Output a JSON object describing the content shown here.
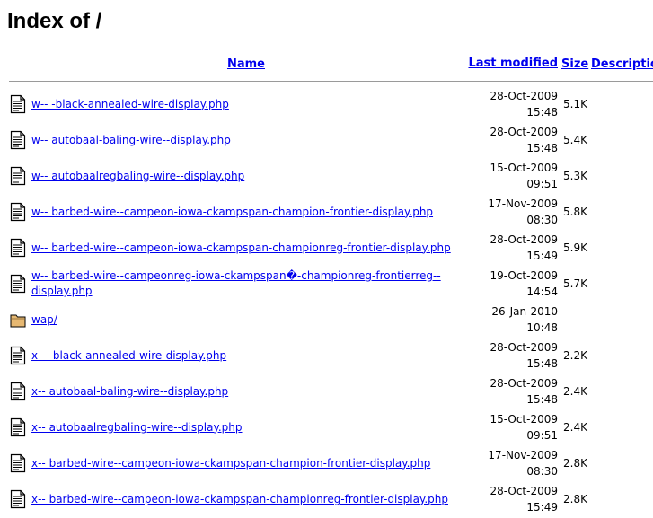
{
  "page": {
    "title": "Index of /"
  },
  "columns": {
    "name": "Name",
    "last_modified": "Last modified",
    "size": "Size",
    "description": "Description"
  },
  "rows": [
    {
      "icon": "text-file-icon",
      "name": "w-- -black-annealed-wire-display.php",
      "date": "28-Oct-2009",
      "time": "15:48",
      "size": "5.1K"
    },
    {
      "icon": "text-file-icon",
      "name": "w-- autobaal-baling-wire--display.php",
      "date": "28-Oct-2009",
      "time": "15:48",
      "size": "5.4K"
    },
    {
      "icon": "text-file-icon",
      "name": "w-- autobaalregbaling-wire--display.php",
      "date": "15-Oct-2009",
      "time": "09:51",
      "size": "5.3K"
    },
    {
      "icon": "text-file-icon",
      "name": "w-- barbed-wire--campeon-iowa-ckampspan-champion-frontier-display.php",
      "date": "17-Nov-2009",
      "time": "08:30",
      "size": "5.8K"
    },
    {
      "icon": "text-file-icon",
      "name": "w-- barbed-wire--campeon-iowa-ckampspan-championreg-frontier-display.php",
      "date": "28-Oct-2009",
      "time": "15:49",
      "size": "5.9K"
    },
    {
      "icon": "text-file-icon",
      "name": "w-- barbed-wire--campeonreg-iowa-ckampspan�-championreg-frontierreg--display.php",
      "date": "19-Oct-2009",
      "time": "14:54",
      "size": "5.7K"
    },
    {
      "icon": "folder-icon",
      "name": "wap/",
      "date": "26-Jan-2010",
      "time": "10:48",
      "size": "-"
    },
    {
      "icon": "text-file-icon",
      "name": "x-- -black-annealed-wire-display.php",
      "date": "28-Oct-2009",
      "time": "15:48",
      "size": "2.2K"
    },
    {
      "icon": "text-file-icon",
      "name": "x-- autobaal-baling-wire--display.php",
      "date": "28-Oct-2009",
      "time": "15:48",
      "size": "2.4K"
    },
    {
      "icon": "text-file-icon",
      "name": "x-- autobaalregbaling-wire--display.php",
      "date": "15-Oct-2009",
      "time": "09:51",
      "size": "2.4K"
    },
    {
      "icon": "text-file-icon",
      "name": "x-- barbed-wire--campeon-iowa-ckampspan-champion-frontier-display.php",
      "date": "17-Nov-2009",
      "time": "08:30",
      "size": "2.8K"
    },
    {
      "icon": "text-file-icon",
      "name": "x-- barbed-wire--campeon-iowa-ckampspan-championreg-frontier-display.php",
      "date": "28-Oct-2009",
      "time": "15:49",
      "size": "2.8K"
    }
  ],
  "colors": {
    "link": "#0000ee",
    "rule": "#9a9a9a",
    "folder": "#e6b872"
  }
}
